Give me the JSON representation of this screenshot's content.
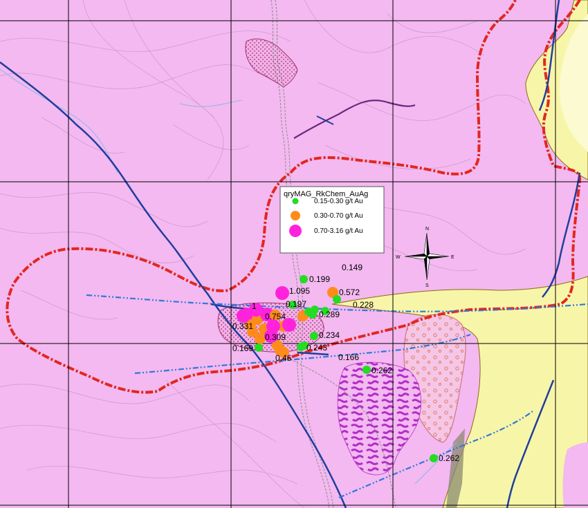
{
  "legend": {
    "title": "qryMAG_RkChem_AuAg",
    "items": [
      {
        "label": "0.15-0.30 g/t Au",
        "color": "#22dd22"
      },
      {
        "label": "0.30-0.70 g/t Au",
        "color": "#ff8c1a"
      },
      {
        "label": "0.70-3.16 g/t Au",
        "color": "#ff22dd"
      }
    ]
  },
  "compass": {
    "n": "N",
    "s": "S",
    "e": "E",
    "w": "W"
  },
  "samples": [
    {
      "label": "0.199",
      "cls": 0
    },
    {
      "label": "0.149",
      "cls": -1
    },
    {
      "label": "1.095",
      "cls": 2
    },
    {
      "label": "0.572",
      "cls": 1
    },
    {
      "label": "0.197",
      "cls": 0
    },
    {
      "label": "0.228",
      "cls": 0
    },
    {
      "label": "1",
      "cls": 2
    },
    {
      "label": "0.754",
      "cls": 1
    },
    {
      "label": "0.289",
      "cls": 0
    },
    {
      "label": "0.331",
      "cls": 2
    },
    {
      "label": "0.309",
      "cls": 2
    },
    {
      "label": "0.234",
      "cls": 0
    },
    {
      "label": "0.169",
      "cls": 0
    },
    {
      "label": "0.243",
      "cls": 0
    },
    {
      "label": "0.46",
      "cls": 1
    },
    {
      "label": "0.166",
      "cls": -1
    },
    {
      "label": "0.262",
      "cls": 0
    },
    {
      "label": "0.262",
      "cls": 0
    }
  ],
  "colors": {
    "background": "#f3b9f0",
    "granite_yellow": "#f7f5a8",
    "boundary_red": "#e3261f",
    "fault_blue": "#1f3f9f",
    "lineament_blue": "#2d78d8",
    "contour": "#c58fc6",
    "grid": "#000000"
  }
}
